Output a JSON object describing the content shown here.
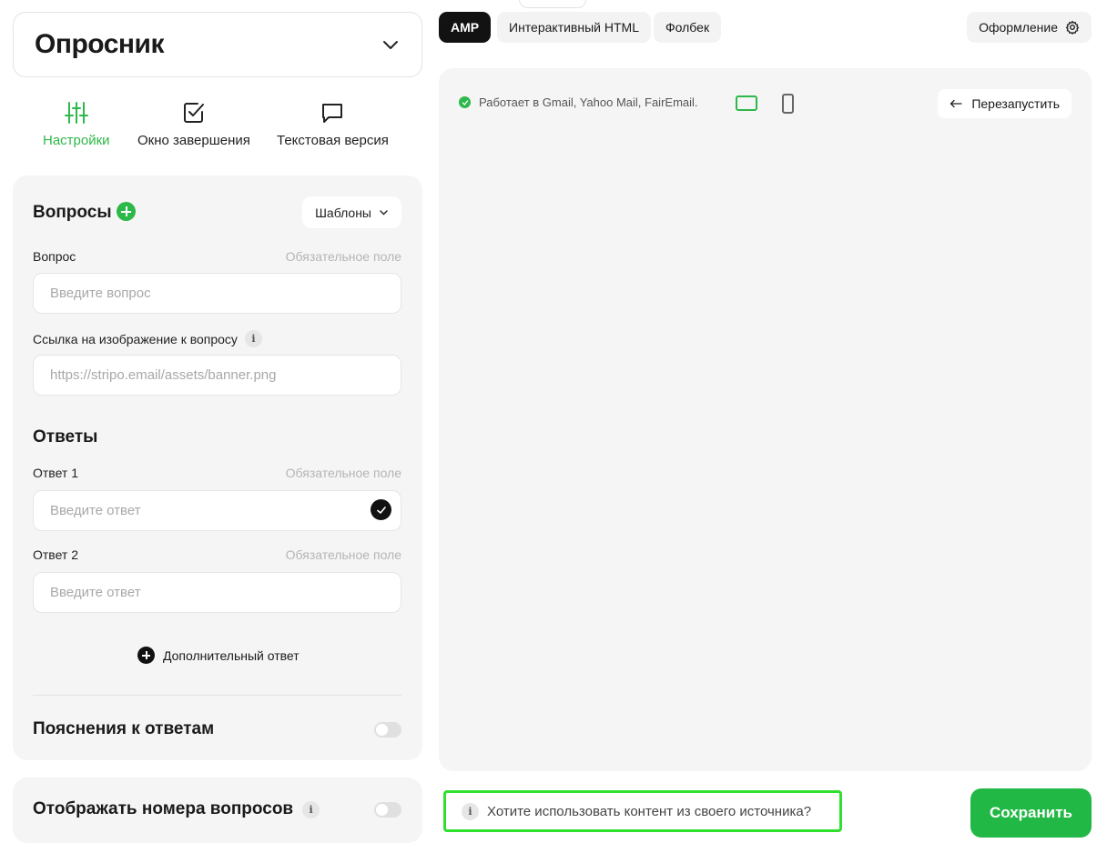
{
  "header": {
    "title": "Опросник",
    "chevron_icon": "chevron-down-icon"
  },
  "mode_tabs": [
    {
      "label": "Настройки",
      "icon": "sliders-icon",
      "active": true
    },
    {
      "label": "Окно завершения",
      "icon": "checkbox-icon",
      "active": false
    },
    {
      "label": "Текстовая версия",
      "icon": "chat-bubble-icon",
      "active": false
    }
  ],
  "questions": {
    "title": "Вопросы",
    "templates_label": "Шаблоны",
    "question_label": "Вопрос",
    "required_label": "Обязательное поле",
    "question_placeholder": "Введите вопрос",
    "image_label": "Ссылка на изображение к вопросу",
    "image_placeholder": "https://stripo.email/assets/banner.png"
  },
  "answers": {
    "title": "Ответы",
    "items": [
      {
        "label": "Ответ 1",
        "required": "Обязательное поле",
        "placeholder": "Введите ответ",
        "correct": true
      },
      {
        "label": "Ответ 2",
        "required": "Обязательное поле",
        "placeholder": "Введите ответ",
        "correct": false
      }
    ],
    "add_label": "Дополнительный ответ"
  },
  "explanations": {
    "title": "Пояснения к ответам",
    "enabled": false
  },
  "numbering": {
    "title": "Отображать номера вопросов",
    "enabled": false
  },
  "top_tabs": [
    {
      "label": "AMP",
      "active": true
    },
    {
      "label": "Интерактивный HTML",
      "active": false
    },
    {
      "label": "Фолбек",
      "active": false
    }
  ],
  "design_label": "Оформление",
  "preview": {
    "compat_text": "Работает в Gmail, Yahoo Mail, FairEmail.",
    "restart_label": "Перезапустить"
  },
  "source_hint": "Хотите использовать контент из своего источника?",
  "save_label": "Сохранить",
  "colors": {
    "accent": "#2db84a",
    "save": "#22b845",
    "highlight": "#2fe02f"
  }
}
